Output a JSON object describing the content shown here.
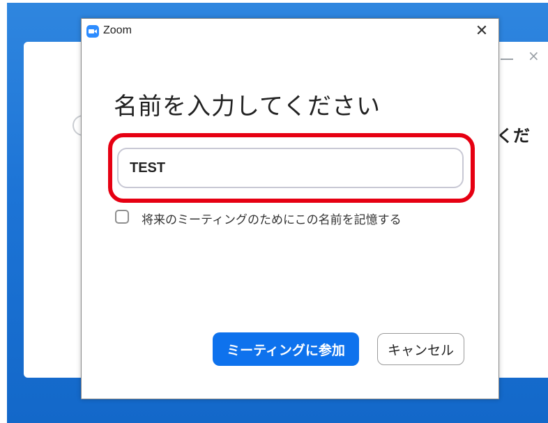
{
  "background_window": {
    "partial_text": "くだ"
  },
  "dialog": {
    "title": "Zoom",
    "heading": "名前を入力してください",
    "name_input": {
      "value": "TEST",
      "placeholder": ""
    },
    "remember_checkbox": {
      "label": "将来のミーティングのためにこの名前を記憶する",
      "checked": false
    },
    "join_button": "ミーティングに参加",
    "cancel_button": "キャンセル"
  },
  "colors": {
    "accent": "#0e72ed",
    "highlight": "#e60012",
    "desktop": "#1d74d6"
  }
}
